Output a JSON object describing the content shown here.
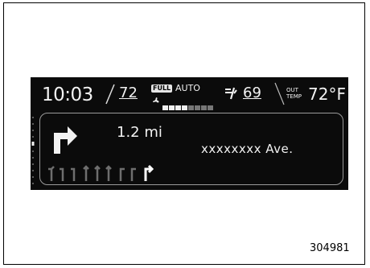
{
  "status": {
    "clock": "10:03",
    "driver_temp": "72",
    "fan_mode_badge": "FULL",
    "fan_mode_text": "AUTO",
    "fan_level": 0.5,
    "passenger_temp": "69",
    "outside_label_line1": "OUT",
    "outside_label_line2": "TEMP",
    "outside_temp": "72°F"
  },
  "nav": {
    "distance": "1.2 mi",
    "street": "xxxxxxxx Ave.",
    "lanes": [
      "left",
      "left",
      "left",
      "straight",
      "straight",
      "straight",
      "right",
      "right",
      "right-active"
    ]
  },
  "figure_id": "304981",
  "colors": {
    "display_bg": "#0b0b0b",
    "text": "#f2f2f2",
    "dim": "#6e6e6e"
  }
}
